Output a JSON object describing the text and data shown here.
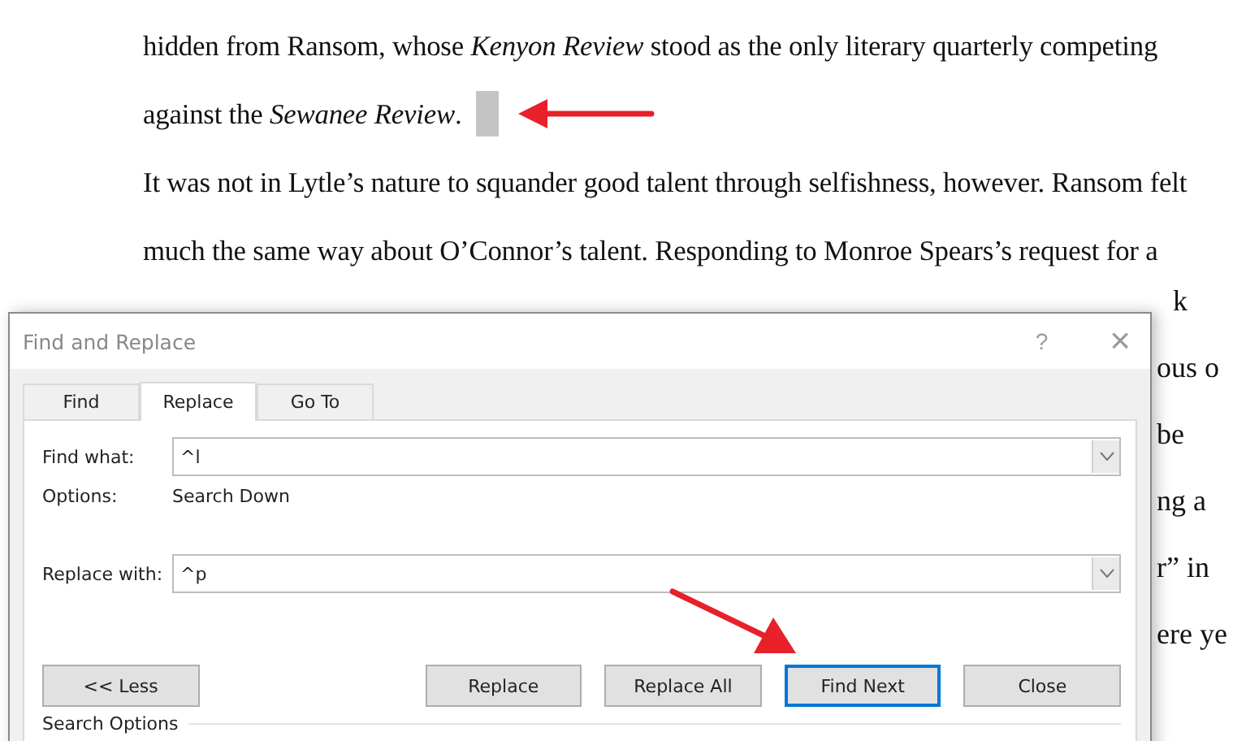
{
  "document": {
    "lines": [
      {
        "text": "hidden from Ransom, whose *Kenyon Review* stood as the only literary quarterly competing",
        "line_break_selected": false
      },
      {
        "text": "against the *Sewanee Review*.",
        "line_break_selected": true
      },
      {
        "text": "It was not in Lytle’s nature to squander good talent through selfishness, however. Ransom felt",
        "line_break_selected": false
      },
      {
        "text": "much the same way about O’Connor’s talent. Responding to Monroe Spears’s request for a",
        "line_break_selected": false
      }
    ],
    "right_fragments": [
      "k",
      "ous o",
      "be",
      "ng a",
      "r” in",
      "ere ye"
    ]
  },
  "dialog": {
    "title": "Find and Replace",
    "help": "?",
    "close": "×",
    "tabs": [
      {
        "label": "Find",
        "selected": false
      },
      {
        "label": "Replace",
        "selected": true
      },
      {
        "label": "Go To",
        "selected": false
      }
    ],
    "find_what": {
      "label": "Find what:",
      "value": "^l"
    },
    "options": {
      "label": "Options:",
      "value": "Search Down"
    },
    "replace_with": {
      "label": "Replace with:",
      "value": "^p"
    },
    "buttons": [
      {
        "label": "<< Less",
        "default": false
      },
      {
        "label": "Replace",
        "default": false
      },
      {
        "label": "Replace All",
        "default": false
      },
      {
        "label": "Find Next",
        "default": true
      },
      {
        "label": "Close",
        "default": false
      }
    ],
    "section": "Search Options"
  }
}
